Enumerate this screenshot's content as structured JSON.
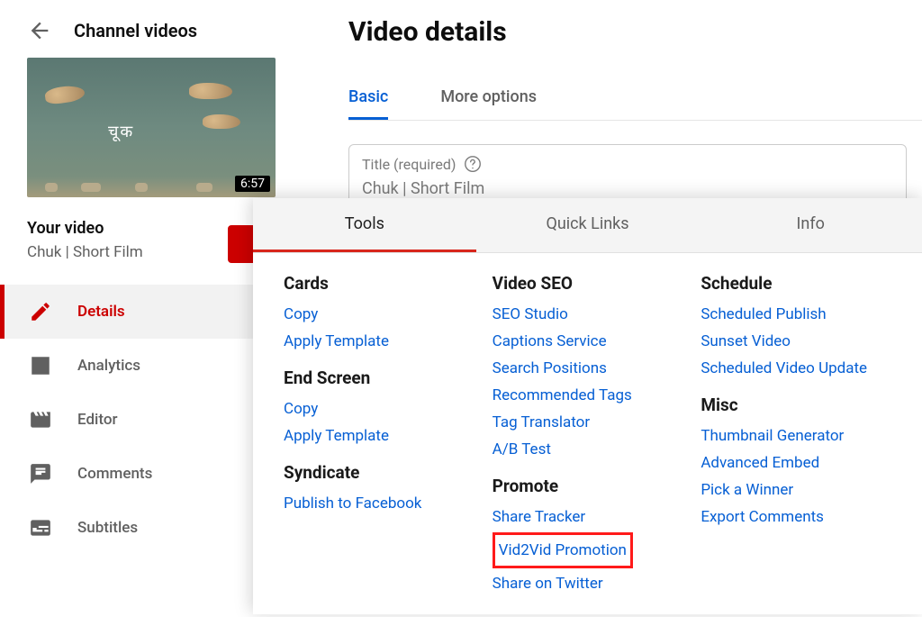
{
  "header": {
    "back_icon": "arrow-back",
    "title": "Channel videos"
  },
  "thumb": {
    "overlay_text": "चूक",
    "duration": "6:57"
  },
  "your_video": {
    "label": "Your video",
    "title": "Chuk | Short Film"
  },
  "sidebar": [
    {
      "icon": "pencil",
      "label": "Details",
      "active": true
    },
    {
      "icon": "analytics",
      "label": "Analytics"
    },
    {
      "icon": "editor",
      "label": "Editor"
    },
    {
      "icon": "comment",
      "label": "Comments"
    },
    {
      "icon": "subtitles",
      "label": "Subtitles"
    }
  ],
  "main": {
    "page_title": "Video details",
    "tabs": [
      {
        "label": "Basic",
        "active": true
      },
      {
        "label": "More options"
      }
    ],
    "title_field": {
      "label": "Title (required)",
      "value": "Chuk | Short Film"
    }
  },
  "overlay": {
    "tabs": [
      {
        "label": "Tools",
        "active": true
      },
      {
        "label": "Quick Links"
      },
      {
        "label": "Info"
      }
    ],
    "columns": [
      {
        "sections": [
          {
            "heading": "Cards",
            "links": [
              "Copy",
              "Apply Template"
            ]
          },
          {
            "heading": "End Screen",
            "links": [
              "Copy",
              "Apply Template"
            ]
          },
          {
            "heading": "Syndicate",
            "links": [
              "Publish to Facebook"
            ]
          }
        ]
      },
      {
        "sections": [
          {
            "heading": "Video SEO",
            "links": [
              "SEO Studio",
              "Captions Service",
              "Search Positions",
              "Recommended Tags",
              "Tag Translator",
              "A/B Test"
            ]
          },
          {
            "heading": "Promote",
            "links": [
              "Share Tracker",
              "Vid2Vid Promotion",
              "Share on Twitter"
            ],
            "highlight": "Vid2Vid Promotion"
          }
        ]
      },
      {
        "sections": [
          {
            "heading": "Schedule",
            "links": [
              "Scheduled Publish",
              "Sunset Video",
              "Scheduled Video Update"
            ]
          },
          {
            "heading": "Misc",
            "links": [
              "Thumbnail Generator",
              "Advanced Embed",
              "Pick a Winner",
              "Export Comments"
            ]
          }
        ]
      }
    ]
  }
}
